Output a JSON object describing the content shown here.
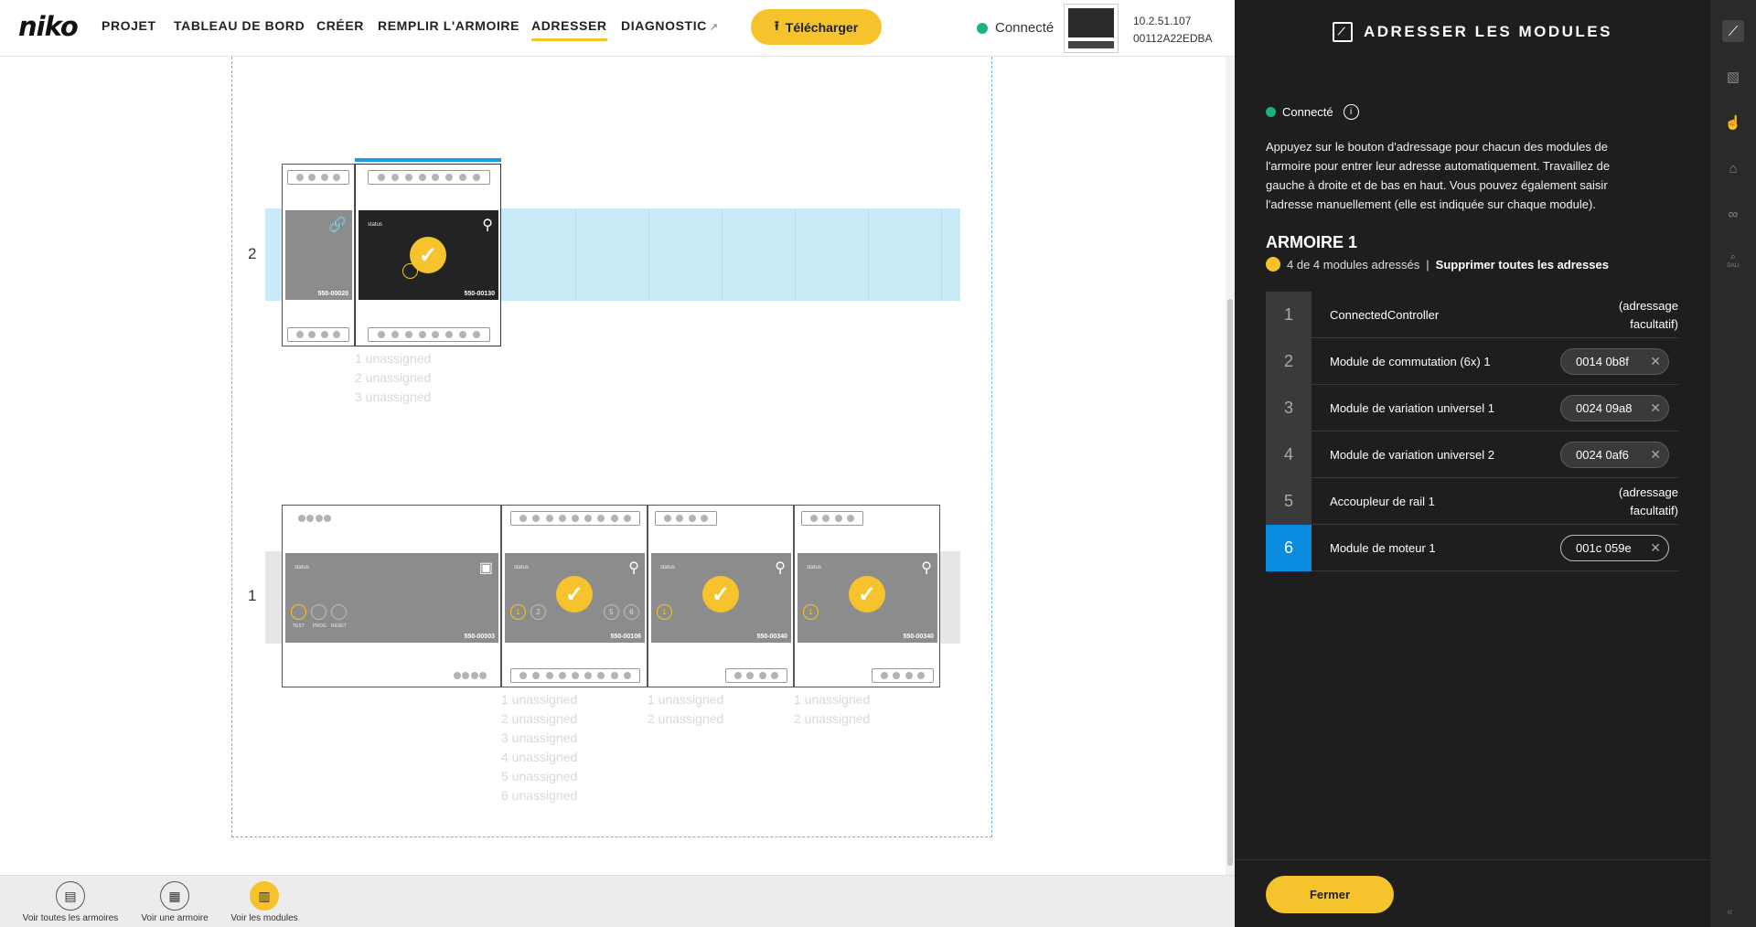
{
  "topbar": {
    "logo": "niko",
    "nav": [
      "PROJET",
      "TABLEAU DE BORD",
      "CRÉER",
      "REMPLIR L'ARMOIRE",
      "ADRESSER",
      "DIAGNOSTIC"
    ],
    "active_nav": "ADRESSER",
    "download_label": "Télécharger",
    "connection_label": "Connecté",
    "ip": "10.2.51.107",
    "serial": "00112A22EDBA"
  },
  "canvas": {
    "rows": [
      {
        "label": "2",
        "modules": [
          {
            "part": "550-00020",
            "state": "unaddressed"
          },
          {
            "part": "550-00130",
            "state": "addressed",
            "unassigned": [
              "1 unassigned",
              "2 unassigned",
              "3 unassigned"
            ]
          }
        ]
      },
      {
        "label": "1",
        "modules": [
          {
            "part": "550-00003",
            "state": "unaddressed",
            "buttons": [
              "TEST",
              "PROG",
              "RESET"
            ]
          },
          {
            "part": "550-00106",
            "state": "addressed",
            "unassigned": [
              "1 unassigned",
              "2 unassigned",
              "3 unassigned",
              "4 unassigned",
              "5 unassigned",
              "6 unassigned"
            ]
          },
          {
            "part": "550-00340",
            "state": "addressed",
            "unassigned": [
              "1 unassigned",
              "2 unassigned"
            ]
          },
          {
            "part": "550-00340",
            "state": "addressed",
            "unassigned": [
              "1 unassigned",
              "2 unassigned"
            ]
          }
        ]
      }
    ],
    "status_text": "status"
  },
  "bottombar": {
    "buttons": [
      "Voir toutes les armoires",
      "Voir une armoire",
      "Voir les modules"
    ],
    "active": "Voir les modules"
  },
  "panel": {
    "title": "ADRESSER LES MODULES",
    "connection": "Connecté",
    "description": "Appuyez sur le bouton d'adressage pour chacun des modules de l'armoire pour entrer leur adresse automatiquement. Travaillez de gauche à droite et de bas en haut. Vous pouvez également saisir l'adresse manuellement (elle est indiquée sur chaque module).",
    "armoire_title": "ARMOIRE 1",
    "status_count": "4 de 4 modules adressés",
    "status_separator": "|",
    "delete_all": "Supprimer toutes les adresses",
    "modules": [
      {
        "num": "1",
        "name": "ConnectedController",
        "optional_line1": "(adressage",
        "optional_line2": "facultatif)"
      },
      {
        "num": "2",
        "name": "Module de commutation (6x) 1",
        "address": "0014 0b8f"
      },
      {
        "num": "3",
        "name": "Module de variation universel 1",
        "address": "0024 09a8"
      },
      {
        "num": "4",
        "name": "Module de variation universel 2",
        "address": "0024 0af6"
      },
      {
        "num": "5",
        "name": "Accoupleur de rail 1",
        "optional_line1": "(adressage",
        "optional_line2": "facultatif)"
      },
      {
        "num": "6",
        "name": "Module de moteur 1",
        "address": "001c 059e",
        "selected": true
      }
    ],
    "close_label": "Fermer"
  },
  "colors": {
    "accent": "#f6c32c",
    "connected": "#1bb37b",
    "selected": "#0b8be0",
    "panel_bg": "#1e1e1e"
  },
  "icons": {
    "side": [
      "address-modules-icon",
      "cabinet-icon",
      "touch-icon",
      "tag-icon",
      "link-icon",
      "dali-icon"
    ],
    "side_dali_label": "DALI"
  }
}
